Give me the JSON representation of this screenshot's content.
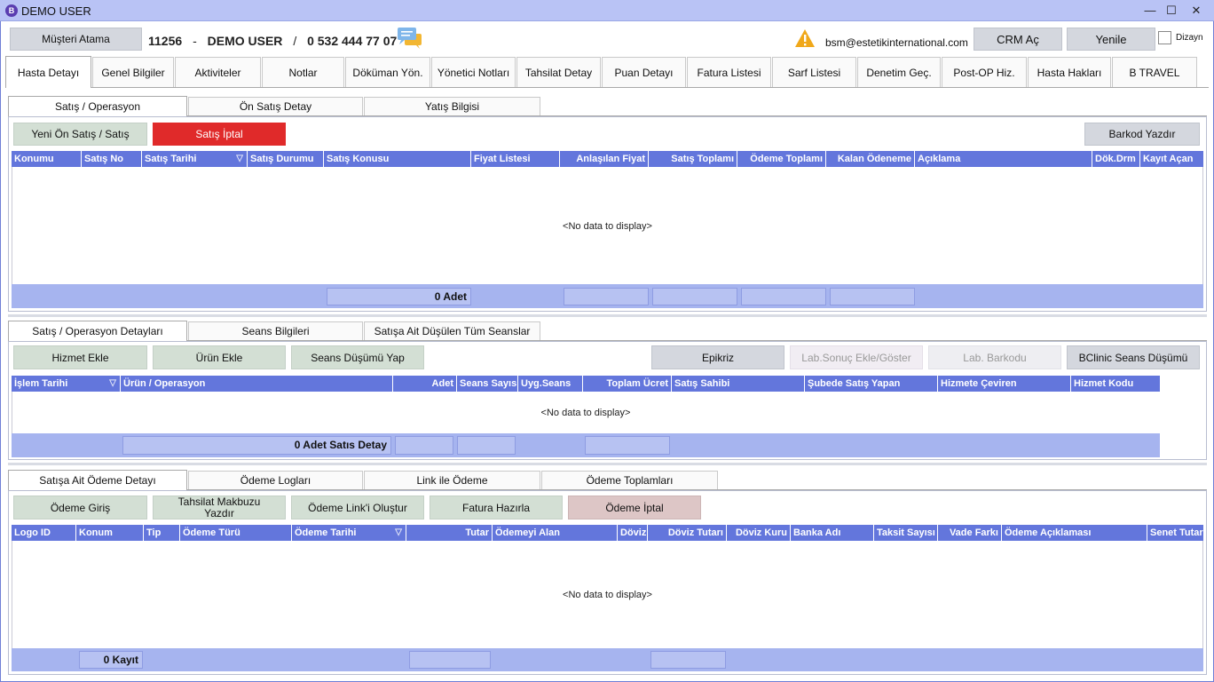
{
  "window": {
    "title": "DEMO USER",
    "logo_letter": "B",
    "controls": {
      "minimize": "—",
      "maximize": "☐",
      "close": "✕"
    }
  },
  "header": {
    "assign_button": "Müşteri Atama",
    "patient_id": "11256",
    "dash": "-",
    "patient_name": "DEMO USER",
    "slash": "/",
    "phone": "0 532 444 77 07",
    "email": "bsm@estetikinternational.com",
    "crm_button": "CRM Aç",
    "refresh_button": "Yenile",
    "design_label": "Dizayn"
  },
  "main_tabs": [
    "Hasta Detayı",
    "Genel Bilgiler",
    "Aktiviteler",
    "Notlar",
    "Döküman Yön.",
    "Yönetici Notları",
    "Tahsilat Detay",
    "Puan Detayı",
    "Fatura Listesi",
    "Sarf Listesi",
    "Denetim Geç.",
    "Post-OP Hiz.",
    "Hasta Hakları",
    "B TRAVEL"
  ],
  "section1": {
    "tabs": [
      "Satış / Operasyon",
      "Ön Satış Detay",
      "Yatış Bilgisi"
    ],
    "buttons": {
      "new_sale": "Yeni Ön Satış / Satış",
      "cancel_sale": "Satış İptal",
      "barcode": "Barkod Yazdır"
    },
    "columns": [
      "Konumu",
      "Satış No",
      "Satış Tarihi",
      "Satış Durumu",
      "Satış Konusu",
      "Fiyat Listesi",
      "Anlaşılan Fiyat",
      "Satış Toplamı",
      "Ödeme Toplamı",
      "Kalan Ödeneme",
      "Açıklama",
      "Dök.Drm",
      "Kayıt Açan"
    ],
    "empty_text": "<No data to display>",
    "footer_count": "0 Adet"
  },
  "section2": {
    "tabs": [
      "Satış / Operasyon Detayları",
      "Seans Bilgileri",
      "Satışa Ait Düşülen Tüm Seanslar"
    ],
    "buttons": {
      "add_service": "Hizmet Ekle",
      "add_product": "Ürün Ekle",
      "session_drop": "Seans Düşümü Yap",
      "epikriz": "Epikriz",
      "lab_result": "Lab.Sonuç Ekle/Göster",
      "lab_barcode": "Lab. Barkodu",
      "bclinic": "BClinic Seans Düşümü"
    },
    "columns": [
      "İşlem Tarihi",
      "Ürün / Operasyon",
      "Adet",
      "Seans Sayısı",
      "Uyg.Seans",
      "Toplam Ücret",
      "Satış Sahibi",
      "Şubede Satış Yapan",
      "Hizmete Çeviren",
      "Hizmet Kodu"
    ],
    "empty_text": "<No data to display>",
    "footer_count": "0 Adet Satıs Detay"
  },
  "section3": {
    "tabs": [
      "Satışa Ait Ödeme Detayı",
      "Ödeme Logları",
      "Link ile Ödeme",
      "Ödeme Toplamları"
    ],
    "buttons": {
      "payment_entry": "Ödeme Giriş",
      "receipt_print": "Tahsilat Makbuzu Yazdır",
      "create_link": "Ödeme Link'i Oluştur",
      "prepare_invoice": "Fatura Hazırla",
      "cancel_payment": "Ödeme İptal"
    },
    "columns": [
      "Logo ID",
      "Konum",
      "Tip",
      "Ödeme Türü",
      "Ödeme Tarihi",
      "Tutar",
      "Ödemeyi Alan",
      "Döviz",
      "Döviz Tutarı",
      "Döviz Kuru",
      "Banka Adı",
      "Taksit Sayısı",
      "Vade Farkı",
      "Ödeme Açıklaması",
      "Senet Tutarı"
    ],
    "empty_text": "<No data to display>",
    "footer_count": "0 Kayıt"
  },
  "icons": {
    "filter": "filter-icon",
    "chat": "chat-icon",
    "warning": "warning-icon"
  },
  "colors": {
    "grid_header": "#6376dc",
    "grid_footer": "#a6b4ef",
    "danger": "#e02a2a",
    "title_bar": "#b9c3f5"
  }
}
